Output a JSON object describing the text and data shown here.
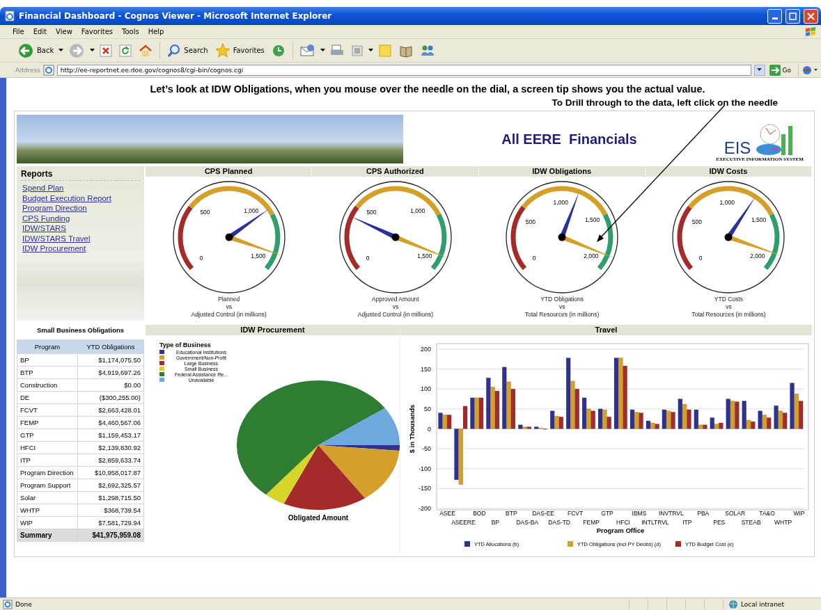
{
  "window": {
    "title": "Financial Dashboard - Cognos Viewer - Microsoft Internet Explorer"
  },
  "menu": [
    "File",
    "Edit",
    "View",
    "Favorites",
    "Tools",
    "Help"
  ],
  "toolbar": {
    "back": "Back",
    "search": "Search",
    "favorites": "Favorites"
  },
  "address_bar": {
    "label": "Address",
    "url": "http://ee-reportnet.ee.doe.gov/cognos8/cgi-bin/cognos.cgi",
    "go": "Go"
  },
  "instructions": [
    "Let’s look at IDW Obligations, when you mouse over the needle on the dial, a screen tip shows you the actual value.",
    "To Drill through to the data, left click on the needle"
  ],
  "banner": {
    "title": "All EERE  Financials",
    "logo": "EIS",
    "logo_caption": "EXECUTIVE INFORMATION SYSTEM"
  },
  "reports": {
    "heading": "Reports",
    "links": [
      "Spend Plan",
      "Budget Execution Report",
      "Program Direction",
      "CPS Funding",
      "IDW/STARS",
      "IDW/STARS Travel",
      "IDW Procurement"
    ]
  },
  "small_business": {
    "title": "Small Business Obligations",
    "columns": [
      "Program",
      "YTD Obligations"
    ],
    "rows": [
      [
        "BP",
        "$1,174,075.50"
      ],
      [
        "BTP",
        "$4,919,697.26"
      ],
      [
        "Construction",
        "$0.00"
      ],
      [
        "DE",
        "($300,255.00)"
      ],
      [
        "FCVT",
        "$2,663,428.01"
      ],
      [
        "FEMP",
        "$4,460,567.06"
      ],
      [
        "GTP",
        "$1,159,453.17"
      ],
      [
        "HFCI",
        "$2,139,830.92"
      ],
      [
        "ITP",
        "$2,859,633.74"
      ],
      [
        "Program Direction",
        "$10,958,017.87"
      ],
      [
        "Program Support",
        "$2,692,325.57"
      ],
      [
        "Solar",
        "$1,298,715.50"
      ],
      [
        "WHTP",
        "$368,739.54"
      ],
      [
        "WIP",
        "$7,581,729.94"
      ]
    ],
    "summary": [
      "Summary",
      "$41,975,959.08"
    ]
  },
  "gauges": [
    {
      "title": "CPS Planned",
      "scale": [
        "500",
        "1,000",
        "0",
        "1,500"
      ],
      "needles": [
        {
          "color": "#d4a02a",
          "level": 0.92
        },
        {
          "color": "#2b2f9a",
          "level": 0.71
        }
      ],
      "caption": [
        "Planned",
        "vs",
        "Adjusted Control (in millions)"
      ]
    },
    {
      "title": "CPS Authorized",
      "scale": [
        "500",
        "1,000",
        "0",
        "1,500"
      ],
      "needles": [
        {
          "color": "#d4a02a",
          "level": 0.93
        },
        {
          "color": "#2b2f9a",
          "level": 0.25
        }
      ],
      "caption": [
        "Approved Amount",
        "vs",
        "Adjusted Control (in millions)"
      ]
    },
    {
      "title": "IDW Obligations",
      "scale": [
        "0",
        "500",
        "1,000",
        "1,500",
        "2,000"
      ],
      "needles": [
        {
          "color": "#d4a02a",
          "level": 0.93
        },
        {
          "color": "#2b2f9a",
          "level": 0.58
        }
      ],
      "caption": [
        "YTD Obligations",
        "vs",
        "Total Resources (in millions)"
      ]
    },
    {
      "title": "IDW Costs",
      "scale": [
        "0",
        "500",
        "1,000",
        "1,500",
        "2,000"
      ],
      "needles": [
        {
          "color": "#d4a02a",
          "level": 0.92
        },
        {
          "color": "#2b2f9a",
          "level": 0.63
        }
      ],
      "caption": [
        "YTD Costs",
        "vs",
        "Total Resources (in millions)"
      ]
    }
  ],
  "procurement": {
    "title": "IDW Procurement",
    "legend_title": "Type of Business",
    "legend": [
      {
        "label": "Educational Institutions",
        "color": "#2e3192"
      },
      {
        "label": "Government/Non-Profit",
        "color": "#d4a02a"
      },
      {
        "label": "Large Business",
        "color": "#a52a2a"
      },
      {
        "label": "Small Business",
        "color": "#d6d62a"
      },
      {
        "label": "Federal Assistance Re...",
        "color": "#2e7d32"
      },
      {
        "label": "Unavailable",
        "color": "#6fa8dc"
      }
    ],
    "caption": "Obligated Amount"
  },
  "travel": {
    "title": "Travel",
    "chart_data": {
      "type": "bar",
      "xlabel": "Program Office",
      "ylabel": "$ in Thousands",
      "categories": [
        "ASEE",
        "ASEERE",
        "BOD",
        "BP",
        "BTP",
        "DAS-BA",
        "DAS-EE",
        "DAS-TD",
        "FCVT",
        "FEMP",
        "GTP",
        "HFCI",
        "IBMS",
        "INTLTRVL",
        "INVTRVL",
        "ITP",
        "PBA",
        "PES",
        "SOLAR",
        "STEAB",
        "TA&O",
        "WHTP",
        "WIP"
      ],
      "series": [
        {
          "name": "YTD Allocations (b)",
          "color": "#2e3192",
          "values": [
            40,
            -128,
            78,
            128,
            155,
            10,
            5,
            45,
            178,
            78,
            50,
            178,
            48,
            20,
            48,
            75,
            48,
            28,
            75,
            70,
            45,
            58,
            115
          ]
        },
        {
          "name": "YTD Obligations (incl PY Deobs) (d)",
          "color": "#d4a02a",
          "values": [
            35,
            -140,
            78,
            105,
            118,
            5,
            2,
            32,
            120,
            50,
            48,
            178,
            42,
            15,
            45,
            62,
            10,
            12,
            70,
            22,
            35,
            45,
            88
          ]
        },
        {
          "name": "YTD Budget Cost (e)",
          "color": "#a52a2a",
          "values": [
            35,
            57,
            78,
            95,
            100,
            5,
            0,
            30,
            100,
            45,
            30,
            158,
            40,
            12,
            42,
            48,
            10,
            15,
            68,
            18,
            28,
            40,
            70
          ]
        }
      ],
      "grid": true,
      "legend": "bottom",
      "ylim": [
        -200,
        200
      ],
      "yticks": [
        -200,
        -150,
        -100,
        -50,
        0,
        50,
        100,
        150,
        200
      ]
    }
  },
  "status_bar": {
    "text": "Done",
    "zone": "Local intranet"
  }
}
